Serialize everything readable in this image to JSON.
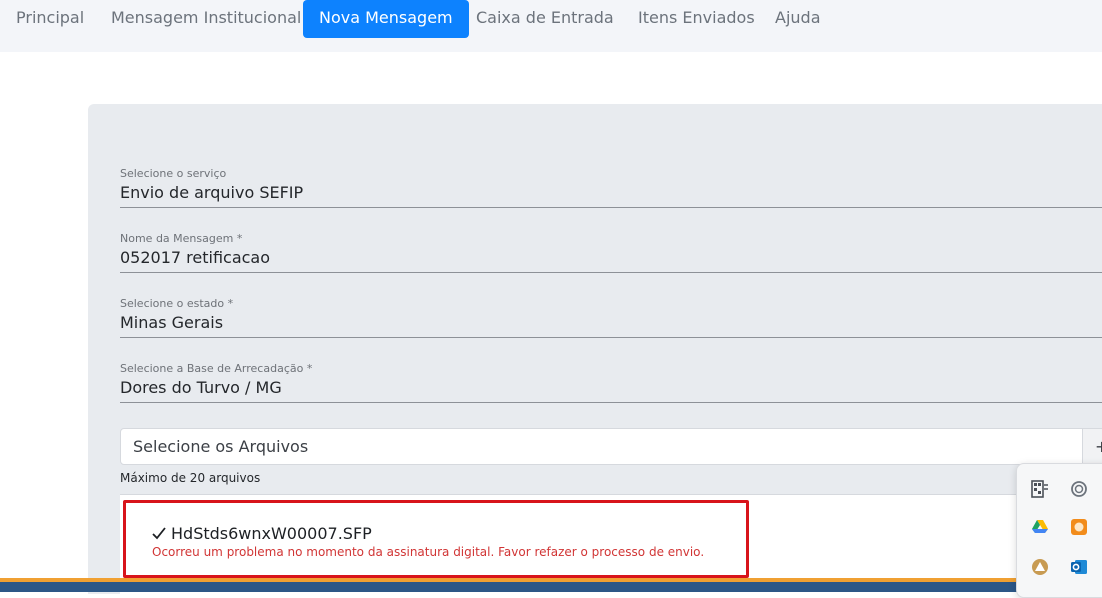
{
  "nav": {
    "items": [
      {
        "label": "Principal"
      },
      {
        "label": "Mensagem Institucional"
      },
      {
        "label": "Nova Mensagem"
      },
      {
        "label": "Caixa de Entrada"
      },
      {
        "label": "Itens Enviados"
      },
      {
        "label": "Ajuda"
      }
    ],
    "active": "Nova Mensagem",
    "active_color": "#0d82fe"
  },
  "form": {
    "service": {
      "label": "Selecione o serviço",
      "value": "Envio de arquivo SEFIP"
    },
    "message_name": {
      "label": "Nome da Mensagem *",
      "value": "052017 retificacao"
    },
    "state": {
      "label": "Selecione o estado *",
      "value": "Minas Gerais"
    },
    "base": {
      "label": "Selecione a Base de Arrecadação *",
      "value": "Dores do Turvo / MG"
    },
    "files": {
      "placeholder": "Selecione os Arquivos",
      "button_label": "+",
      "hint": "Máximo de 20 arquivos"
    }
  },
  "uploaded": {
    "file_name": "HdStds6wnxW00007.SFP",
    "error": "Ocorreu um problema no momento da assinatura digital. Favor refazer o processo de envio.",
    "error_color": "#d13535"
  },
  "tray": {
    "icons": [
      "qr-scanner-icon",
      "settings-ring-icon",
      "google-drive-icon",
      "orange-app-icon",
      "triangle-app-icon",
      "outlook-icon"
    ]
  }
}
